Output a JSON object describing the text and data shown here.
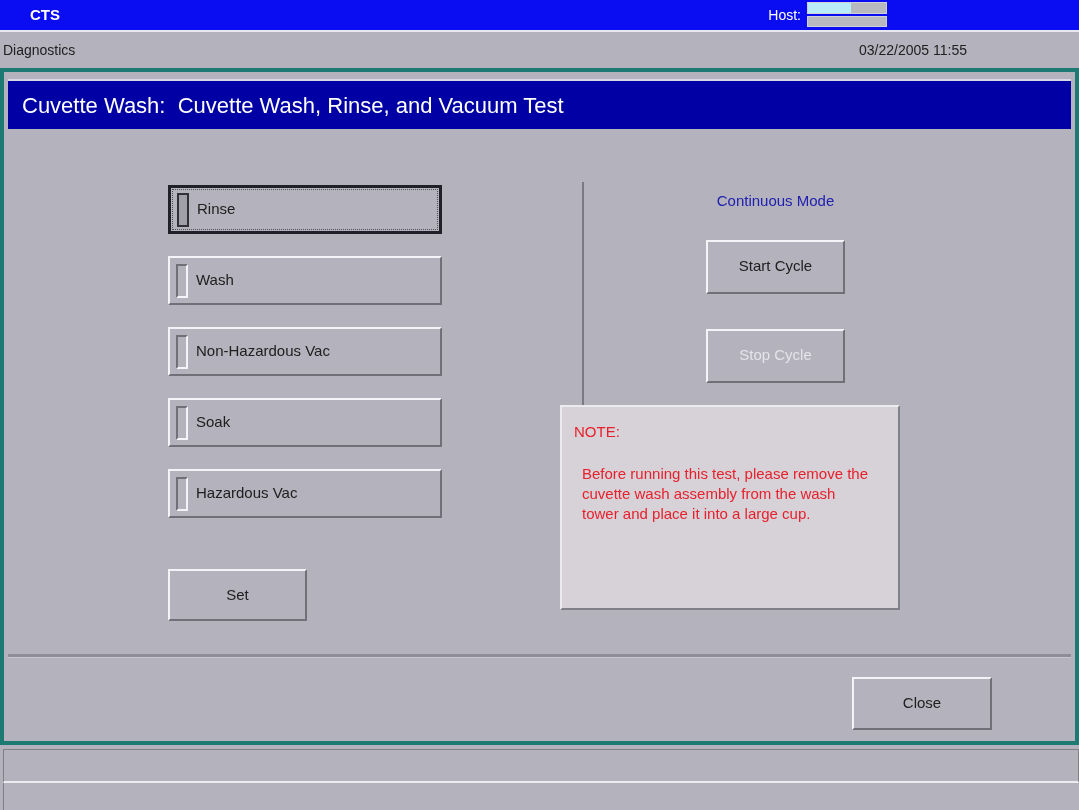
{
  "app_bar": {
    "title": "CTS",
    "host_label": "Host:",
    "host_indicator": {
      "level": 0.55
    }
  },
  "header": {
    "section": "Diagnostics",
    "datetime": "03/22/2005 11:55"
  },
  "dialog": {
    "title": "Cuvette Wash:  Cuvette Wash, Rinse, and Vacuum Test",
    "toggles": [
      {
        "label": "Rinse",
        "focused": true,
        "on": false
      },
      {
        "label": "Wash",
        "focused": false,
        "on": false
      },
      {
        "label": "Non-Hazardous Vac",
        "focused": false,
        "on": false
      },
      {
        "label": "Soak",
        "focused": false,
        "on": false
      },
      {
        "label": "Hazardous Vac",
        "focused": false,
        "on": false
      }
    ],
    "set_button": "Set",
    "mode_label": "Continuous Mode",
    "cycle_buttons": [
      {
        "label": "Start Cycle",
        "disabled": false
      },
      {
        "label": "Stop Cycle",
        "disabled": true
      }
    ],
    "note": {
      "heading": "NOTE:",
      "text": "Before running this test, please remove the cuvette wash assembly from the wash tower and place it into a large cup."
    },
    "close_button": "Close"
  }
}
